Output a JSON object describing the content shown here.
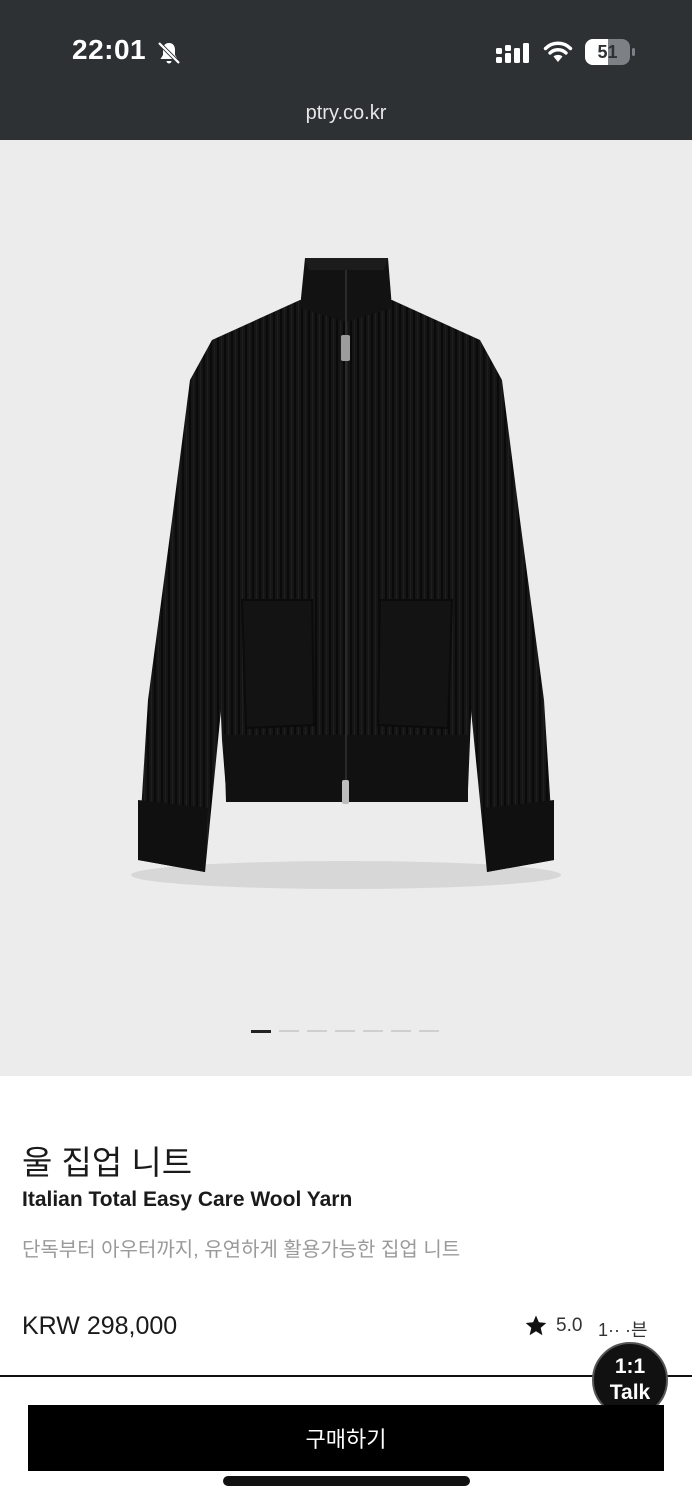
{
  "status_bar": {
    "time": "22:01",
    "battery_level": "51",
    "icons": [
      "bell-slash-icon",
      "cellular-signal-icon",
      "wifi-icon",
      "battery-icon"
    ]
  },
  "browser": {
    "url": "ptry.co.kr"
  },
  "gallery": {
    "image_count": 7,
    "active_index": 0,
    "image_subject": "black ribbed knit zip-up cardigan"
  },
  "product": {
    "name_ko": "울 집업 니트",
    "subtitle": "Italian Total Easy Care Wool Yarn",
    "description": "단독부터 아우터까지, 유연하게 활용가능한 집업 니트",
    "price": "KRW 298,000",
    "rating": "5.0",
    "reviews_partial": "1·· ·븐"
  },
  "talk_button": {
    "line1": "1:1",
    "line2": "Talk"
  },
  "buy_button": {
    "label": "구매하기"
  },
  "colors": {
    "status_bar": "#2e3134",
    "image_bg": "#ececec",
    "button_bg": "#000000",
    "desc_text": "#9a9a9a"
  }
}
